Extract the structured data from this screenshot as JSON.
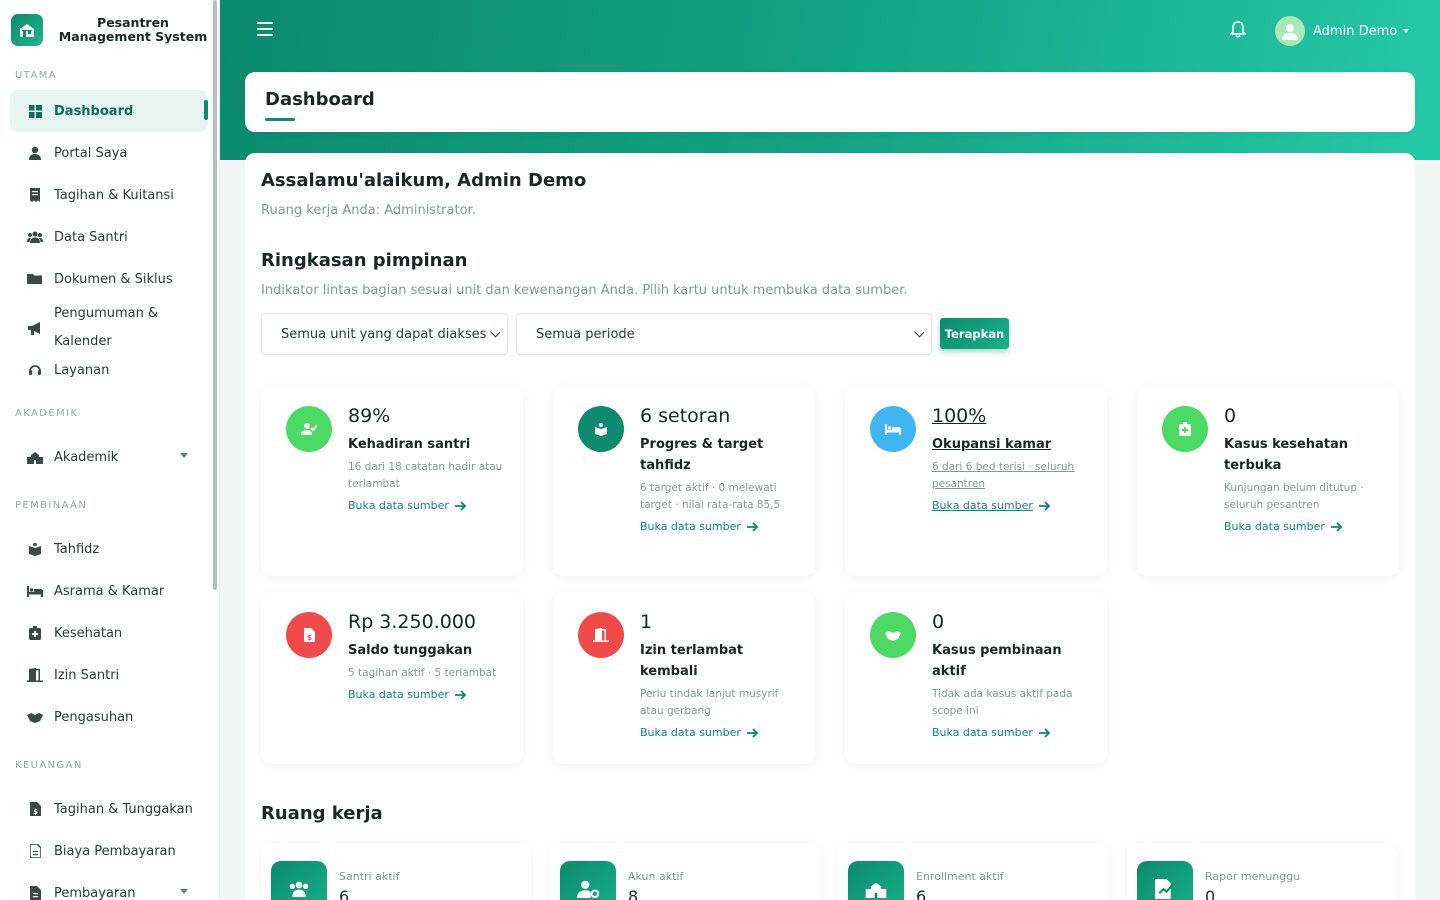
{
  "brand": {
    "title": "Pesantren Management System"
  },
  "sidebar": {
    "sections": [
      {
        "label": "UTAMA"
      },
      {
        "label": "AKADEMIK"
      },
      {
        "label": "PEMBINAAN"
      },
      {
        "label": "KEUANGAN"
      }
    ],
    "items": [
      {
        "label": "Dashboard",
        "icon": "grid-icon",
        "active": true
      },
      {
        "label": "Portal Saya",
        "icon": "user-tie-icon"
      },
      {
        "label": "Tagihan & Kuitansi",
        "icon": "receipt-icon"
      },
      {
        "label": "Data Santri",
        "icon": "users-icon"
      },
      {
        "label": "Dokumen & Siklus",
        "icon": "folder-icon"
      },
      {
        "label": "Pengumuman & Kalender",
        "icon": "megaphone-icon"
      },
      {
        "label": "Layanan",
        "icon": "headset-icon"
      },
      {
        "label": "Akademik",
        "icon": "school-icon",
        "has_submenu": true
      },
      {
        "label": "Tahfidz",
        "icon": "quran-icon"
      },
      {
        "label": "Asrama & Kamar",
        "icon": "bed-icon"
      },
      {
        "label": "Kesehatan",
        "icon": "medkit-icon"
      },
      {
        "label": "Izin Santri",
        "icon": "door-open-icon"
      },
      {
        "label": "Pengasuhan",
        "icon": "handshake-icon"
      },
      {
        "label": "Tagihan & Tunggakan",
        "icon": "invoice-dollar-icon"
      },
      {
        "label": "Biaya Pembayaran",
        "icon": "invoice-icon"
      },
      {
        "label": "Pembayaran",
        "icon": "invoice-icon",
        "has_submenu": true
      }
    ]
  },
  "header": {
    "user_name": "Admin Demo",
    "menu_icon": "hamburger-icon",
    "notification_icon": "bell-icon"
  },
  "page": {
    "title": "Dashboard"
  },
  "main": {
    "greeting": "Assalamu'alaikum, Admin Demo",
    "workspace": "Ruang kerja Anda: Administrator.",
    "summary_title": "Ringkasan pimpinan",
    "summary_sub": "Indikator lintas bagian sesuai unit dan kewenangan Anda. Pilih kartu untuk membuka data sumber.",
    "filter_unit": "Semua unit yang dapat diakses",
    "filter_period": "Semua periode",
    "apply_label": "Terapkan",
    "link_label": "Buka data sumber",
    "stats": [
      {
        "value": "89%",
        "label": "Kehadiran santri",
        "desc": "16 dari 18 catatan hadir atau terlambat",
        "color": "#4cd964",
        "icon": "user-check-icon"
      },
      {
        "value": "6 setoran",
        "label": "Progres & target tahfidz",
        "desc": "6 target aktif · 0 melewati target · nilai rata-rata 85,5",
        "color": "#0e8a6e",
        "icon": "quran-icon"
      },
      {
        "value": "100%",
        "label": "Okupansi kamar",
        "desc": "6 dari 6 bed terisi · seluruh pesantren",
        "color": "#3fb6f2",
        "icon": "bed-icon"
      },
      {
        "value": "0",
        "label": "Kasus kesehatan terbuka",
        "desc": "Kunjungan belum ditutup · seluruh pesantren",
        "color": "#4cd964",
        "icon": "medkit-icon"
      },
      {
        "value": "Rp 3.250.000",
        "label": "Saldo tunggakan",
        "desc": "5 tagihan aktif · 5 terlambat",
        "color": "#f04a4a",
        "icon": "invoice-dollar-icon"
      },
      {
        "value": "1",
        "label": "Izin terlambat kembali",
        "desc": "Perlu tindak lanjut musyrif atau gerbang",
        "color": "#f04a4a",
        "icon": "door-open-icon"
      },
      {
        "value": "0",
        "label": "Kasus pembinaan aktif",
        "desc": "Tidak ada kasus aktif pada scope ini",
        "color": "#4cd964",
        "icon": "handshake-icon"
      }
    ],
    "work_title": "Ruang kerja",
    "work": [
      {
        "label": "Santri aktif",
        "value": "6",
        "icon": "users-icon"
      },
      {
        "label": "Akun aktif",
        "value": "8",
        "icon": "user-cog-icon"
      },
      {
        "label": "Enrollment aktif",
        "value": "6",
        "icon": "school-icon"
      },
      {
        "label": "Rapor menunggu",
        "value": "0",
        "icon": "file-signature-icon"
      }
    ]
  }
}
